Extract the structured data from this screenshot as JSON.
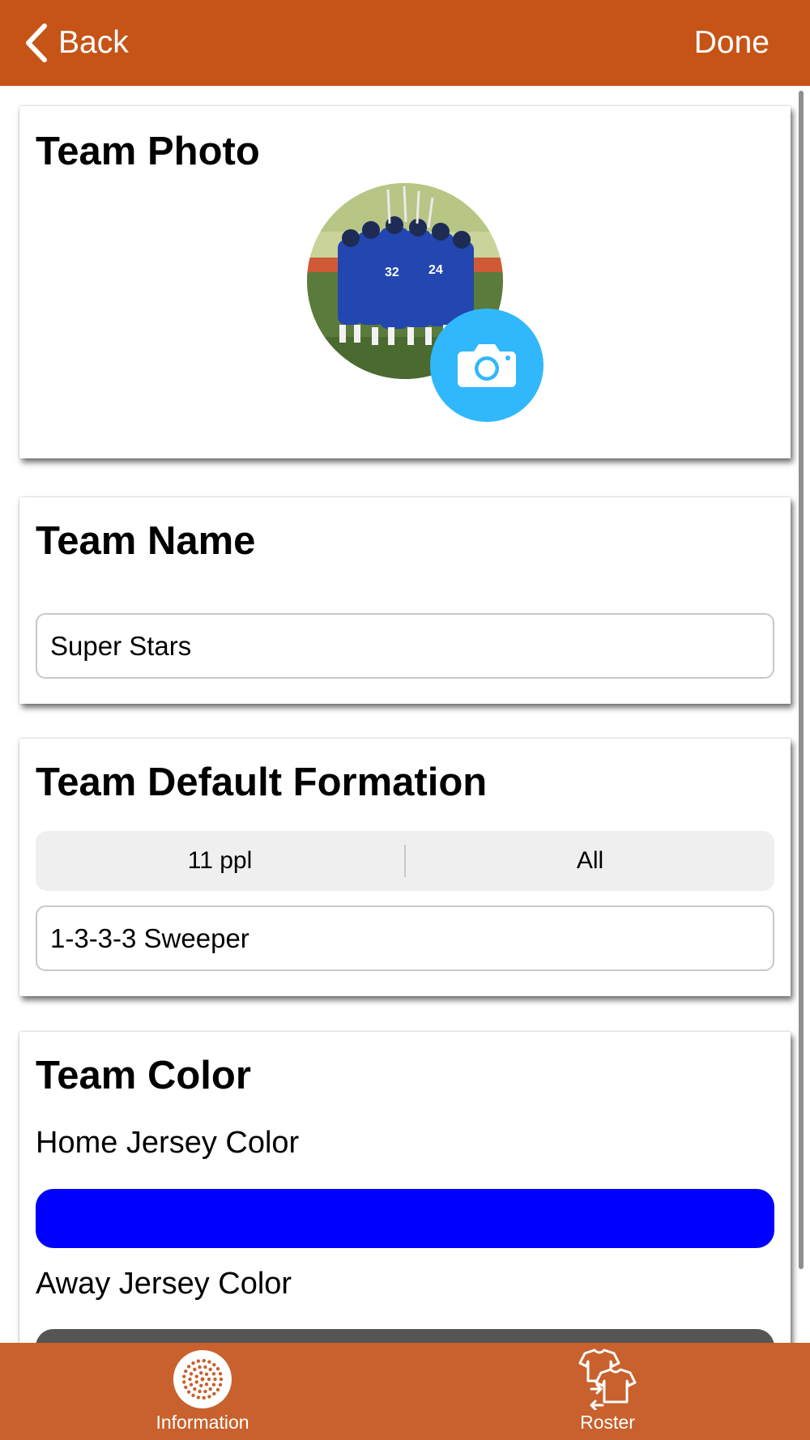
{
  "nav": {
    "back_label": "Back",
    "done_label": "Done"
  },
  "photo_card": {
    "title": "Team Photo",
    "camera_icon": "camera-icon"
  },
  "name_card": {
    "title": "Team Name",
    "name_value": "Super Stars"
  },
  "formation_card": {
    "title": "Team Default Formation",
    "segments": [
      "11 ppl",
      "All"
    ],
    "formation_value": "1-3-3-3 Sweeper"
  },
  "color_card": {
    "title": "Team Color",
    "home_label": "Home Jersey Color",
    "home_color": "#0000ff",
    "away_label": "Away Jersey Color",
    "away_color": "#555555"
  },
  "tabs": [
    {
      "label": "Information",
      "icon": "soccer-ball-icon"
    },
    {
      "label": "Roster",
      "icon": "jersey-swap-icon"
    }
  ],
  "colors": {
    "header": "#c65417",
    "tabbar": "#c8612d",
    "accent": "#31b8fc"
  }
}
